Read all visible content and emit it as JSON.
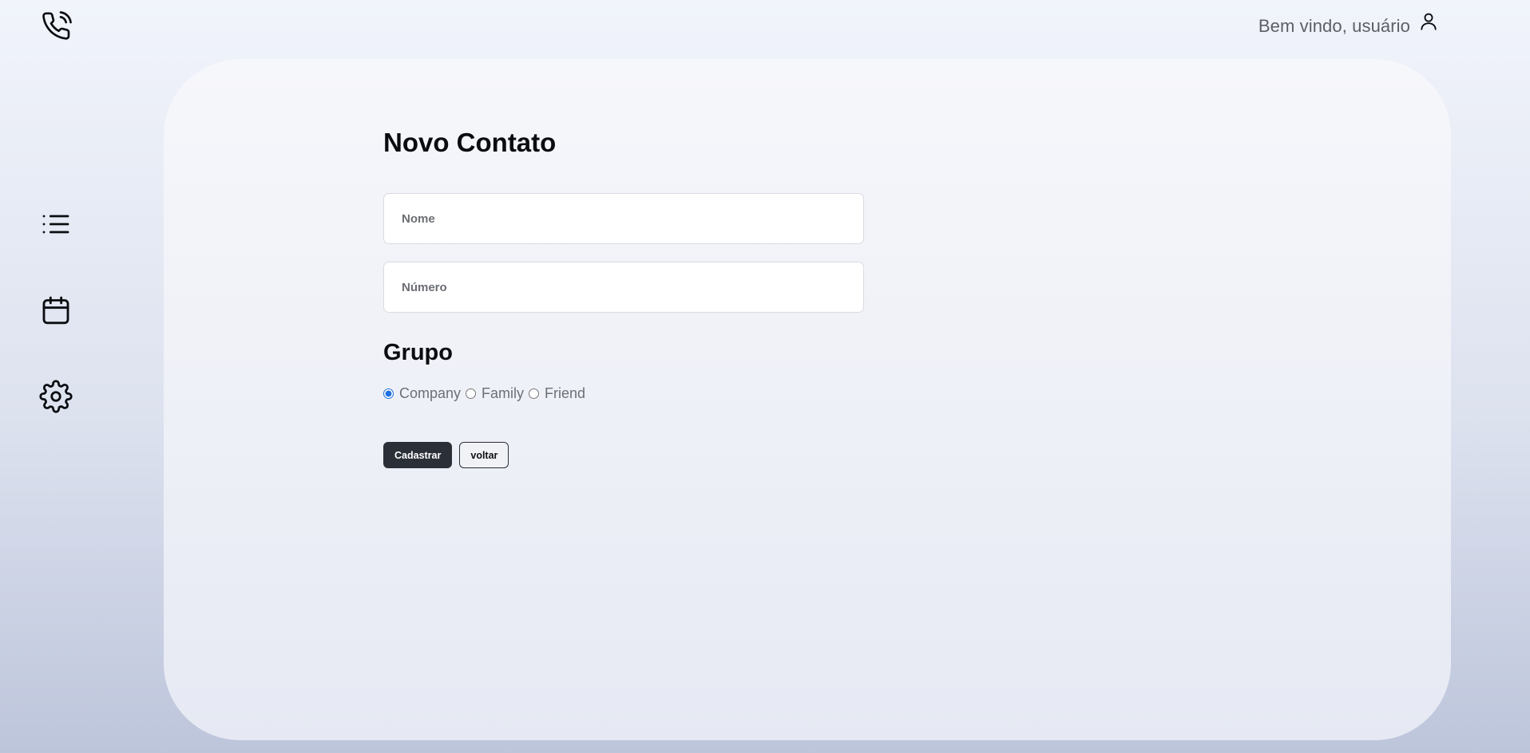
{
  "header": {
    "logo_icon": "phone-calling-icon",
    "welcome_text": "Bem vindo, usuário",
    "user_icon": "user-icon"
  },
  "sidebar": {
    "items": [
      {
        "icon": "list-icon"
      },
      {
        "icon": "calendar-icon"
      },
      {
        "icon": "gear-icon"
      }
    ]
  },
  "form": {
    "title": "Novo Contato",
    "name_placeholder": "Nome",
    "name_value": "",
    "number_placeholder": "Número",
    "number_value": "",
    "group_title": "Grupo",
    "groups": [
      {
        "label": "Company",
        "checked": true
      },
      {
        "label": "Family",
        "checked": false
      },
      {
        "label": "Friend",
        "checked": false
      }
    ],
    "submit_label": "Cadastrar",
    "back_label": "voltar"
  },
  "colors": {
    "primary_button": "#2b3038",
    "radio_accent": "#1f6fe0"
  }
}
